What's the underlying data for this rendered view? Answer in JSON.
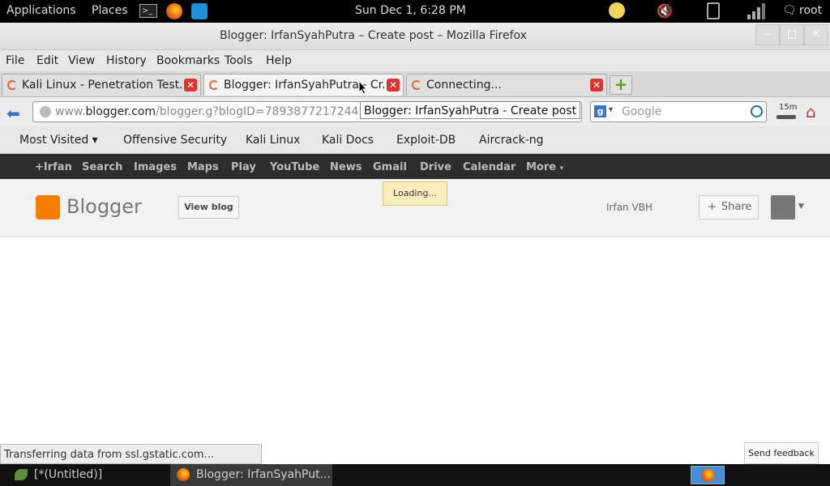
{
  "system": {
    "menus": [
      "Applications",
      "Places"
    ],
    "clock": "Sun Dec  1,  6:28 PM",
    "user": "root"
  },
  "window": {
    "title": "Blogger: IrfanSyahPutra – Create post – Mozilla Firefox",
    "controls": [
      "–",
      "□",
      "✕"
    ]
  },
  "menubar": [
    "File",
    "Edit",
    "View",
    "History",
    "Bookmarks",
    "Tools",
    "Help"
  ],
  "tabs": [
    {
      "label": "Kali Linux - Penetration Test...",
      "active": false
    },
    {
      "label": "Blogger: IrfanSyahPutra - Cr...",
      "active": true
    },
    {
      "label": "Connecting...",
      "active": false
    }
  ],
  "nav": {
    "url_prefix": "www.",
    "url_domain": "blogger.com",
    "url_path": "/blogger.g?blogID=78938772172445",
    "tooltip": "Blogger: IrfanSyahPutra - Create post",
    "search_placeholder": "Google",
    "timer": "15m"
  },
  "bookmarks": [
    "Most Visited",
    "Offensive Security",
    "Kali Linux",
    "Kali Docs",
    "Exploit-DB",
    "Aircrack-ng"
  ],
  "google_bar": [
    "+Irfan",
    "Search",
    "Images",
    "Maps",
    "Play",
    "YouTube",
    "News",
    "Gmail",
    "Drive",
    "Calendar",
    "More"
  ],
  "blogger": {
    "logo_text": "Blogger",
    "view_blog": "View blog",
    "loading": "Loading...",
    "user_name": "Irfan VBH",
    "share": "Share"
  },
  "status_text": "Transferring data from ssl.gstatic.com...",
  "feedback": "Send feedback",
  "taskbar": [
    {
      "label": "[*(Untitled)]",
      "active": false
    },
    {
      "label": "Blogger: IrfanSyahPut...",
      "active": true
    }
  ]
}
